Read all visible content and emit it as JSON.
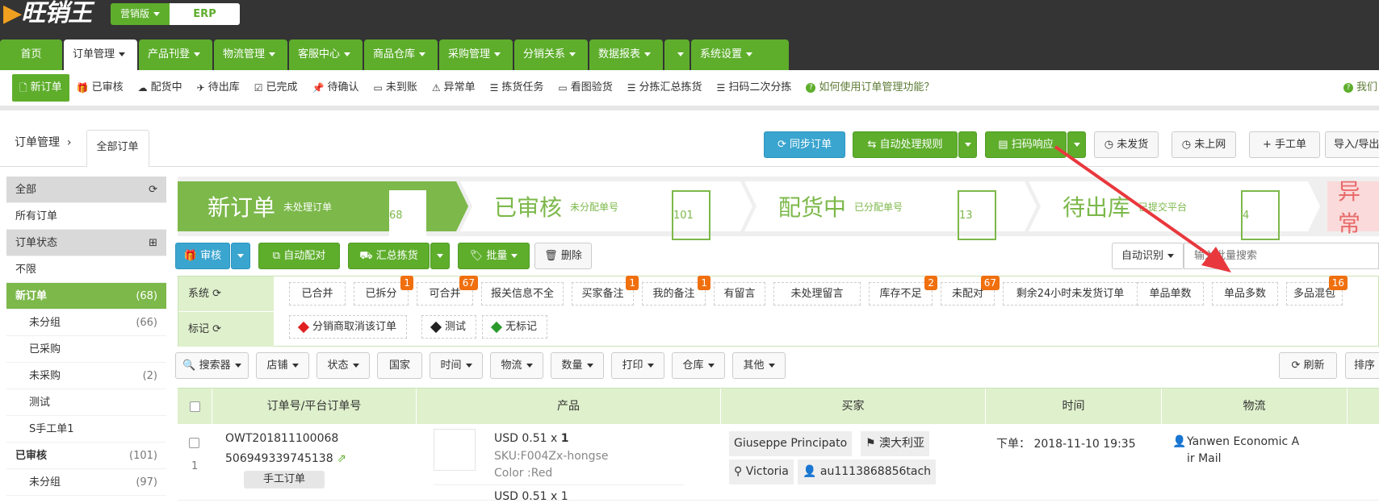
{
  "brand": {
    "logo_text": "旺销王",
    "version_label": "营销版",
    "erp_label": "ERP"
  },
  "nav": {
    "tabs": [
      "首页",
      "订单管理",
      "产品刊登",
      "物流管理",
      "客服中心",
      "商品仓库",
      "采购管理",
      "分销关系",
      "数据报表",
      "",
      "系统设置"
    ]
  },
  "subnav": {
    "items": [
      "新订单",
      "已审核",
      "配货中",
      "待出库",
      "已完成",
      "待确认",
      "未到账",
      "异常单",
      "拣货任务",
      "看图验货",
      "分拣汇总拣货",
      "扫码二次分拣"
    ],
    "help": "如何使用订单管理功能？",
    "help_right": "我们"
  },
  "breadcrumb": {
    "root": "订单管理",
    "current": "全部订单"
  },
  "toolbar": {
    "sync": "同步订单",
    "auto_rule": "自动处理规则",
    "scan": "扫码响应",
    "not_shipped": "未发货",
    "not_online": "未上网",
    "manual": "手工单",
    "import": "导入/导出"
  },
  "sidebar": {
    "all": "全部",
    "all_orders": "所有订单",
    "status_head": "订单状态",
    "unlimited": "不限",
    "new_order": "新订单",
    "new_count": "(68)",
    "items": [
      {
        "label": "未分组",
        "count": "(66)"
      },
      {
        "label": "已采购",
        "count": ""
      },
      {
        "label": "未采购",
        "count": "(2)"
      },
      {
        "label": "测试",
        "count": ""
      },
      {
        "label": "S手工单1",
        "count": ""
      }
    ],
    "audited": "已审核",
    "audited_count": "(101)",
    "audited_sub": "未分组",
    "audited_sub_count": "(97)"
  },
  "stages": [
    {
      "big": "新订单",
      "small": "未处理订单",
      "num": "68"
    },
    {
      "big": "已审核",
      "small": "未分配单号",
      "num": "101"
    },
    {
      "big": "配货中",
      "small": "已分配单号",
      "num": "13"
    },
    {
      "big": "待出库",
      "small": "已提交平台",
      "num": "4"
    },
    {
      "big": "异常",
      "small": "",
      "num": ""
    }
  ],
  "ops": {
    "audit": "审核",
    "auto_match": "自动配对",
    "summary_pick": "汇总拣货",
    "batch": "批量",
    "delete": "删除",
    "auto_detect": "自动识别",
    "search_placeholder": "输入批量搜索"
  },
  "filters": {
    "system_label": "系统",
    "mark_label": "标记",
    "system_chips": [
      {
        "label": "已合并",
        "badge": ""
      },
      {
        "label": "已拆分",
        "badge": "1"
      },
      {
        "label": "可合并",
        "badge": "67"
      },
      {
        "label": "报关信息不全",
        "badge": ""
      },
      {
        "label": "买家备注",
        "badge": "1"
      },
      {
        "label": "我的备注",
        "badge": "1"
      },
      {
        "label": "有留言",
        "badge": ""
      },
      {
        "label": "未处理留言",
        "badge": ""
      },
      {
        "label": "库存不足",
        "badge": "2"
      },
      {
        "label": "未配对",
        "badge": "67"
      },
      {
        "label": "剩余24小时未发货订单",
        "badge": ""
      },
      {
        "label": "单品单数",
        "badge": ""
      },
      {
        "label": "单品多数",
        "badge": ""
      },
      {
        "label": "多品混包",
        "badge": "16"
      }
    ],
    "mark_chips": [
      {
        "label": "分销商取消该订单",
        "color": "#e02020"
      },
      {
        "label": "测试",
        "color": "#222222"
      },
      {
        "label": "无标记",
        "color": "#2a9a2a"
      }
    ]
  },
  "filters2": {
    "items": [
      "搜索器",
      "店铺",
      "状态",
      "国家",
      "时间",
      "物流",
      "数量",
      "打印",
      "仓库",
      "其他"
    ],
    "refresh": "刷新",
    "sort": "排序"
  },
  "table": {
    "headers": [
      "订单号/平台订单号",
      "产品",
      "买家",
      "时间",
      "物流"
    ],
    "row": {
      "index": "1",
      "order_no": "OWT201811100068",
      "platform_no": "506949339745138",
      "manual_tag": "手工订单",
      "price": "USD 0.51 x",
      "qty": "1",
      "sku": "SKU:F004Zx-hongse",
      "color": "Color :Red",
      "price2": "USD 0.51 x 1",
      "buyer": "Giuseppe Principato",
      "country": "澳大利亚",
      "state": "Victoria",
      "buyer_id": "au1113868856tach",
      "time": "下单： 2018-11-10 19:35",
      "logistics": "Yanwen Economic A",
      "logistics2": "ir Mail"
    }
  },
  "colors": {
    "green": "#5eae2c",
    "blue": "#3aa5cf",
    "badge": "#f06f0e",
    "arrow": "#e8383d"
  }
}
